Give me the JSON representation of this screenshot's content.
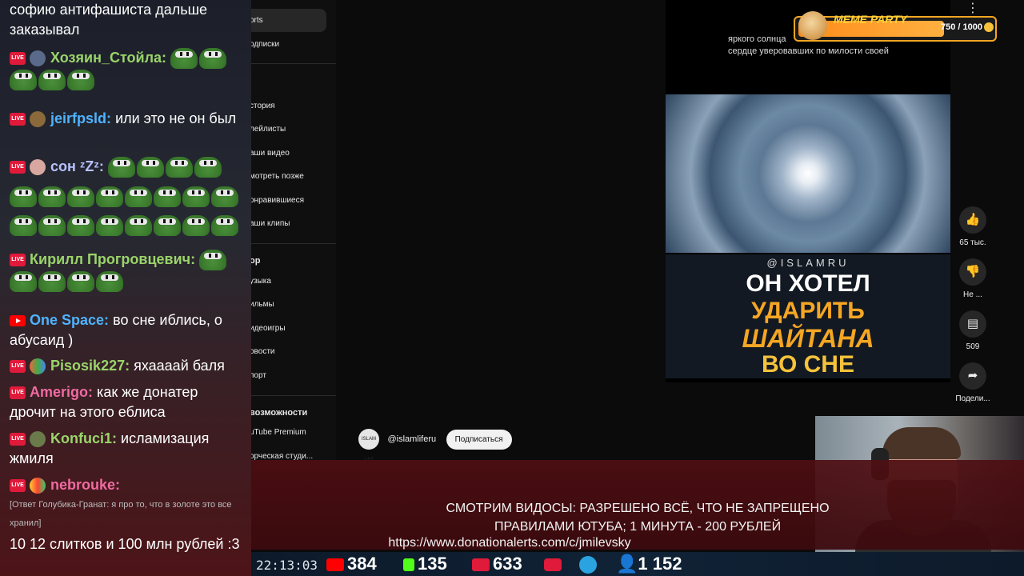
{
  "chat": {
    "messages": [
      {
        "type": "text",
        "text": "софию антифашиста дальше заказывал"
      },
      {
        "type": "msg",
        "platform": "live",
        "user": "Хозяин_Стойла:",
        "user_color": "#9bd46a",
        "text": "",
        "emotes": 6
      },
      {
        "type": "msg",
        "platform": "live",
        "user": "jeirfpsld:",
        "user_color": "#4fb3ff",
        "text": "или это не он был",
        "emotes": 0
      },
      {
        "type": "msg",
        "platform": "live",
        "user": "сон ᶻZᶻ:",
        "user_color": "#b7c2ff",
        "text": "",
        "emotes": 20
      },
      {
        "type": "msg",
        "platform": "live",
        "user": "Кирилл Прогровцевич:",
        "user_color": "#9bd46a",
        "text": "",
        "emotes": 5
      },
      {
        "type": "msg",
        "platform": "youtube",
        "user": "One Space:",
        "user_color": "#4fb3ff",
        "text": "во сне иблись, о абусаид )",
        "emotes": 0
      },
      {
        "type": "msg",
        "platform": "live",
        "user": "Pisosik227:",
        "user_color": "#9bd46a",
        "text": "яхаааай баля",
        "emotes": 0
      },
      {
        "type": "msg",
        "platform": "live",
        "user": "Amerigo:",
        "user_color": "#f06aa0",
        "text": "как же донатер дрочит на этого еблиса",
        "emotes": 0
      },
      {
        "type": "msg",
        "platform": "live",
        "user": "Konfuci1:",
        "user_color": "#9bd46a",
        "text": "исламизация жмиля",
        "emotes": 0
      },
      {
        "type": "msg",
        "platform": "live",
        "user": "nebrouke:",
        "user_color": "#f06aa0",
        "text": "",
        "emotes": 0
      },
      {
        "type": "reply",
        "text": "[Ответ Голубика-Гранат: я про то, что в золоте это все хранил]"
      },
      {
        "type": "text",
        "text": "10 12 слитков и 100 млн рублей :3"
      }
    ]
  },
  "sidebar": {
    "items": [
      {
        "label": "orts"
      },
      {
        "label": "одписки"
      },
      {
        "label": "стория"
      },
      {
        "label": "лейлисты"
      },
      {
        "label": "аши видео"
      },
      {
        "label": "мотреть позже"
      },
      {
        "label": "онравившиеся"
      },
      {
        "label": "аши клипы"
      },
      {
        "label": "ор"
      },
      {
        "label": "узыка"
      },
      {
        "label": "ильмы"
      },
      {
        "label": "идеоигры"
      },
      {
        "label": "овости"
      },
      {
        "label": "порт"
      },
      {
        "label": "возможности"
      },
      {
        "label": "uTube Premium"
      },
      {
        "label": "орческая студи..."
      }
    ]
  },
  "channel": {
    "avatar_text": "ISLAM LIFE",
    "name": "@islamliferu",
    "subscribe_label": "Подписаться"
  },
  "video": {
    "description_lines": [
      "яркого солнца",
      "сердце уверовавших по милости своей"
    ],
    "handle": "@ISLAMRU",
    "title_line1": "ОН ХОТЕЛ",
    "title_line2": "УДАРИТЬ",
    "title_line3": "ШАЙТАНА",
    "title_line4": "ВО СНЕ"
  },
  "actions": {
    "like_count": "65 тыс.",
    "dislike_label": "Не ...",
    "comments_count": "509",
    "share_label": "Подели..."
  },
  "meme_party": {
    "title": "MEME PARTY",
    "value": "750 / 1000",
    "progress": 0.75
  },
  "banner": {
    "line1": "СМОТРИМ ВИДОСЫ: РАЗРЕШЕНО ВСЁ, ЧТО НЕ ЗАПРЕЩЕНО",
    "line2": "ПРАВИЛАМИ ЮТУБА; 1 МИНУТА - 200 РУБЛЕЙ",
    "line3": "https://www.donationalerts.com/c/jmilevsky"
  },
  "stats": {
    "clock": "22:13:03",
    "youtube": "384",
    "kick": "135",
    "live": "633",
    "telegram_viewers": "",
    "total": "1 152"
  },
  "colors": {
    "accent": "#f5a623",
    "live_red": "#e01a3a",
    "banner_bg": "#4e0e12"
  }
}
